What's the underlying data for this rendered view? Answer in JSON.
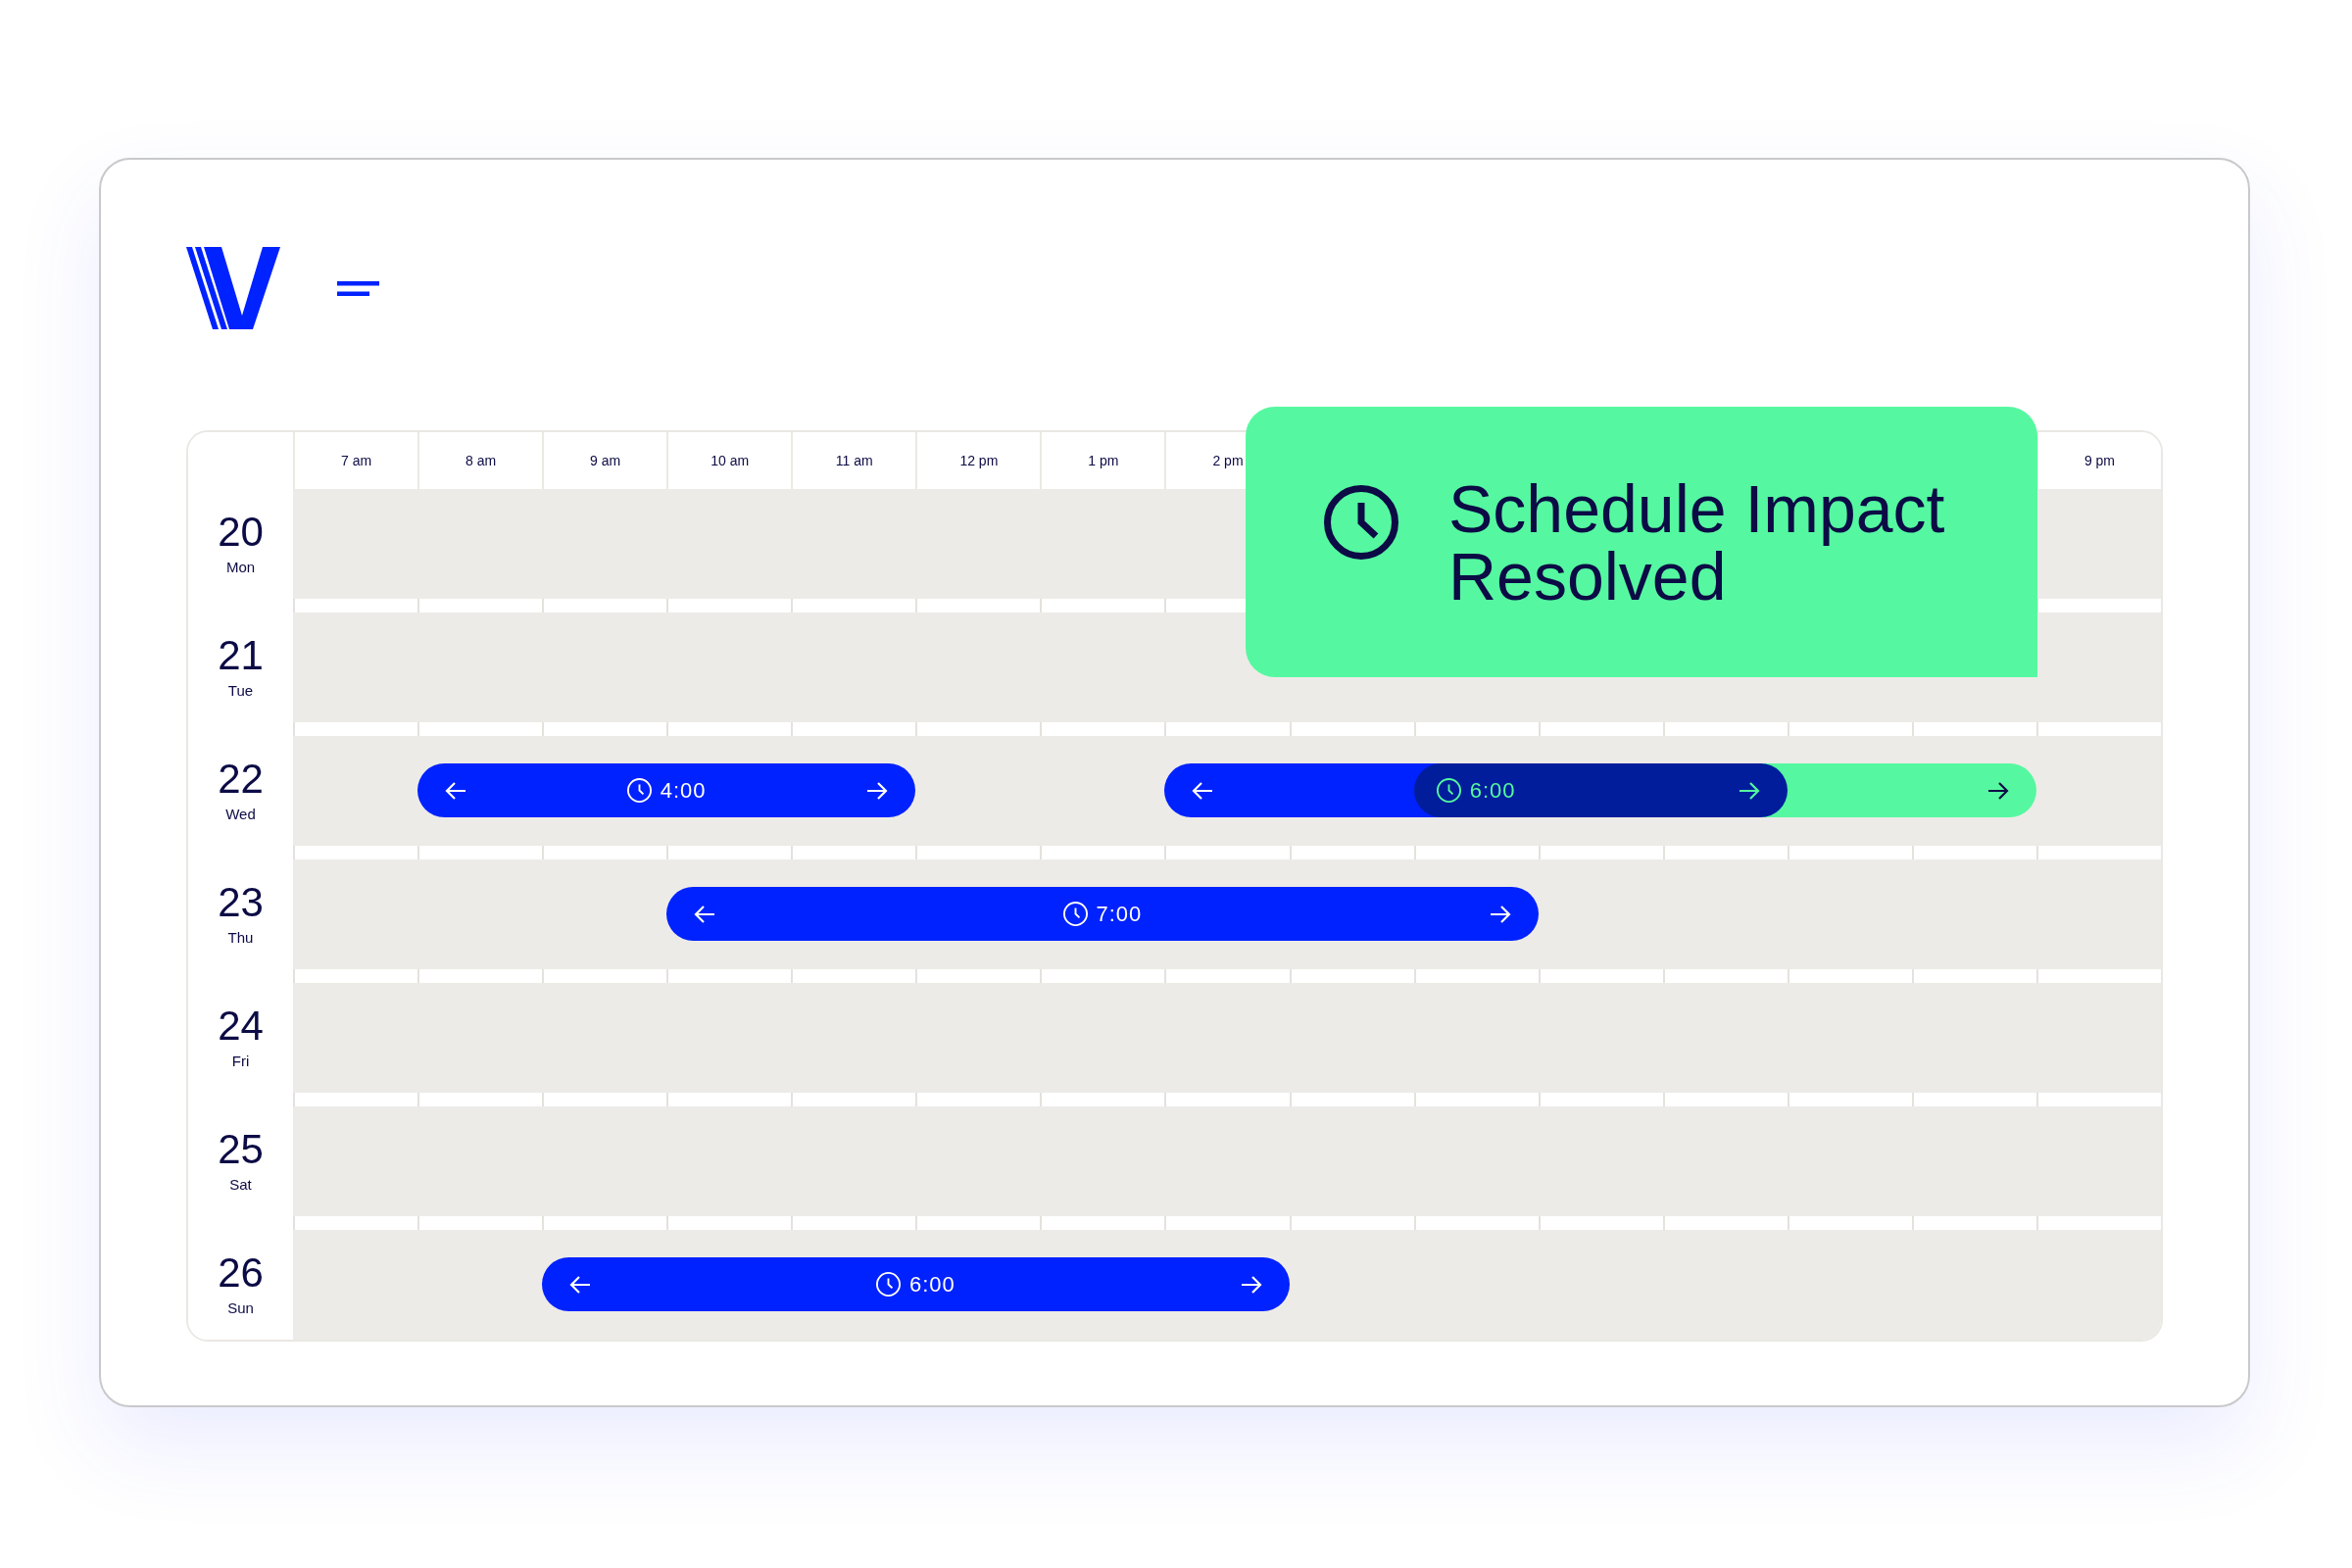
{
  "calendar": {
    "columns": [
      {
        "label": "7 am"
      },
      {
        "label": "8 am"
      },
      {
        "label": "9 am"
      },
      {
        "label": "10 am"
      },
      {
        "label": "11 am"
      },
      {
        "label": "12 pm"
      },
      {
        "label": "1 pm"
      },
      {
        "label": "2 pm"
      },
      {},
      {},
      {},
      {},
      {},
      {},
      {
        "label": "9 pm"
      }
    ],
    "days": [
      {
        "date": "20",
        "weekday": "Mon"
      },
      {
        "date": "21",
        "weekday": "Tue"
      },
      {
        "date": "22",
        "weekday": "Wed",
        "events": [
          {
            "kind": "shift",
            "duration": "4:00",
            "color": "#0022ff"
          },
          {
            "kind": "shift",
            "duration": "6:00",
            "color": "#0022ff"
          },
          {
            "kind": "extension",
            "color": "#55f8a0"
          }
        ]
      },
      {
        "date": "23",
        "weekday": "Thu",
        "events": [
          {
            "kind": "shift",
            "duration": "7:00",
            "color": "#0022ff"
          }
        ]
      },
      {
        "date": "24",
        "weekday": "Fri"
      },
      {
        "date": "25",
        "weekday": "Sat"
      },
      {
        "date": "26",
        "weekday": "Sun",
        "events": [
          {
            "kind": "shift",
            "duration": "6:00",
            "color": "#0022ff"
          }
        ]
      }
    ]
  },
  "notice": {
    "title": "Schedule Impact Resolved"
  }
}
